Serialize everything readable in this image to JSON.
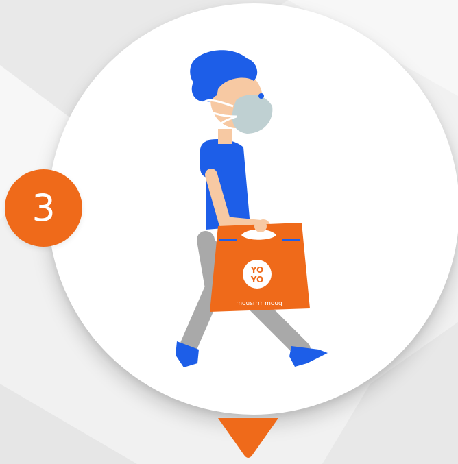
{
  "step": {
    "number": "3"
  },
  "bag": {
    "logo_line1": "YO",
    "logo_line2": "YO",
    "caption": "mousrrrr mouq"
  },
  "colors": {
    "accent_orange": "#ef6a1a",
    "hair_blue": "#1d5ee8",
    "mask_gray": "#bfd0d2",
    "skin": "#f7c9a3",
    "pants_gray": "#a9a9a9",
    "background": "#f1f1f1"
  },
  "icons": {
    "person": "person-walking-icon",
    "bag": "shopping-bag-icon",
    "pointer": "down-triangle-icon"
  }
}
